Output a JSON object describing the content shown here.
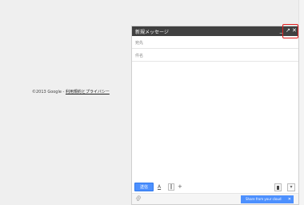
{
  "footer": {
    "copyright": "©2013 Google - ",
    "link": "利用規約とプライバシー"
  },
  "compose": {
    "title": "新規メッセージ",
    "controls": {
      "minimize": "_",
      "popout": "↗",
      "close": "✕"
    },
    "to_placeholder": "宛先",
    "subject_placeholder": "件名",
    "send_label": "送信",
    "format_icon": "A",
    "attach_icon": "‖",
    "more_icon": "+",
    "options_icon": "▾",
    "cloud_label": "Share from your cloud",
    "cloud_close": "✕"
  },
  "colors": {
    "header_bg": "#404040",
    "send_button": "#4d90fe",
    "highlight_border": "#e01d1d"
  }
}
